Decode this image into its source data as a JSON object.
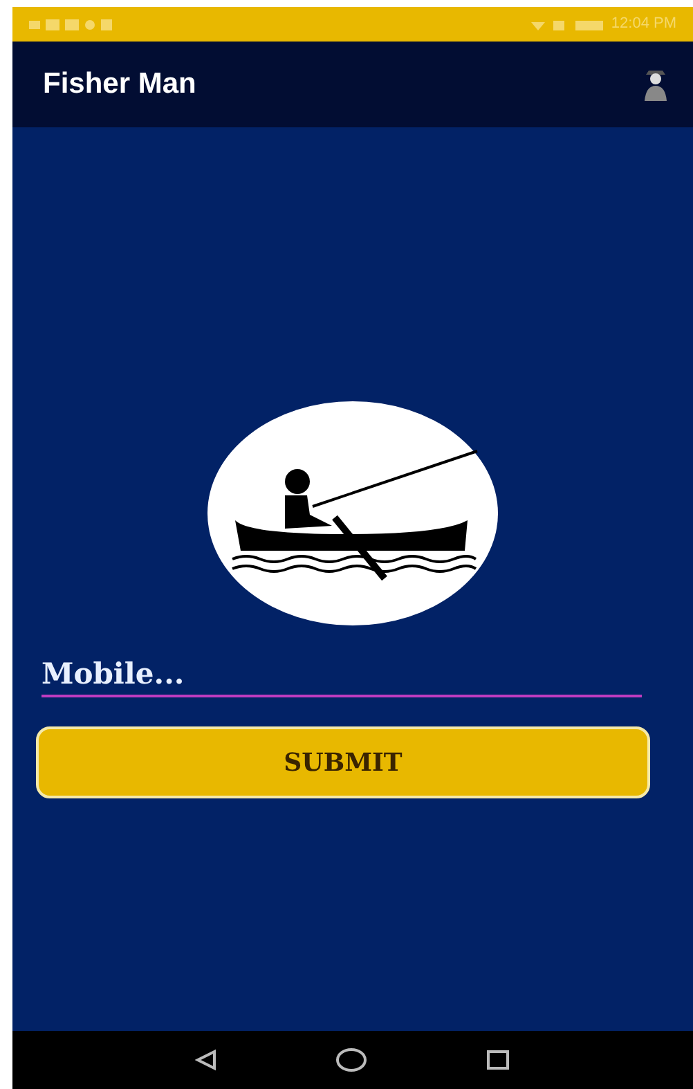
{
  "status_bar": {
    "time": "12:04 PM"
  },
  "app_bar": {
    "title": "Fisher Man"
  },
  "form": {
    "placeholder": "Mobile...",
    "submit": "SUBMIT"
  }
}
